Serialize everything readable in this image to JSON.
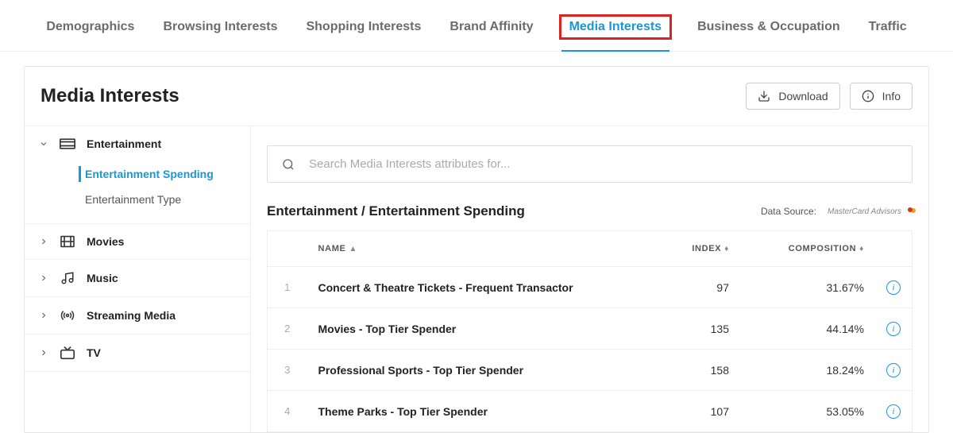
{
  "topnav": {
    "tabs": [
      {
        "label": "Demographics"
      },
      {
        "label": "Browsing Interests"
      },
      {
        "label": "Shopping Interests"
      },
      {
        "label": "Brand Affinity"
      },
      {
        "label": "Media Interests",
        "active": true
      },
      {
        "label": "Business & Occupation"
      },
      {
        "label": "Traffic"
      }
    ]
  },
  "header": {
    "title": "Media Interests",
    "download_label": "Download",
    "info_label": "Info"
  },
  "sidebar": {
    "items": [
      {
        "label": "Entertainment",
        "expanded": true,
        "children": [
          {
            "label": "Entertainment Spending",
            "active": true
          },
          {
            "label": "Entertainment Type"
          }
        ]
      },
      {
        "label": "Movies"
      },
      {
        "label": "Music"
      },
      {
        "label": "Streaming Media"
      },
      {
        "label": "TV"
      }
    ]
  },
  "main": {
    "search_placeholder": "Search Media Interests attributes for...",
    "breadcrumb": "Entertainment / Entertainment Spending",
    "datasource_label": "Data Source:",
    "datasource_name": "MasterCard Advisors",
    "columns": {
      "name": "NAME",
      "index": "INDEX",
      "composition": "COMPOSITION"
    },
    "rows": [
      {
        "n": "1",
        "name": "Concert & Theatre Tickets - Frequent Transactor",
        "index": "97",
        "composition": "31.67%"
      },
      {
        "n": "2",
        "name": "Movies - Top Tier Spender",
        "index": "135",
        "composition": "44.14%"
      },
      {
        "n": "3",
        "name": "Professional Sports - Top Tier Spender",
        "index": "158",
        "composition": "18.24%"
      },
      {
        "n": "4",
        "name": "Theme Parks - Top Tier Spender",
        "index": "107",
        "composition": "53.05%"
      }
    ]
  }
}
